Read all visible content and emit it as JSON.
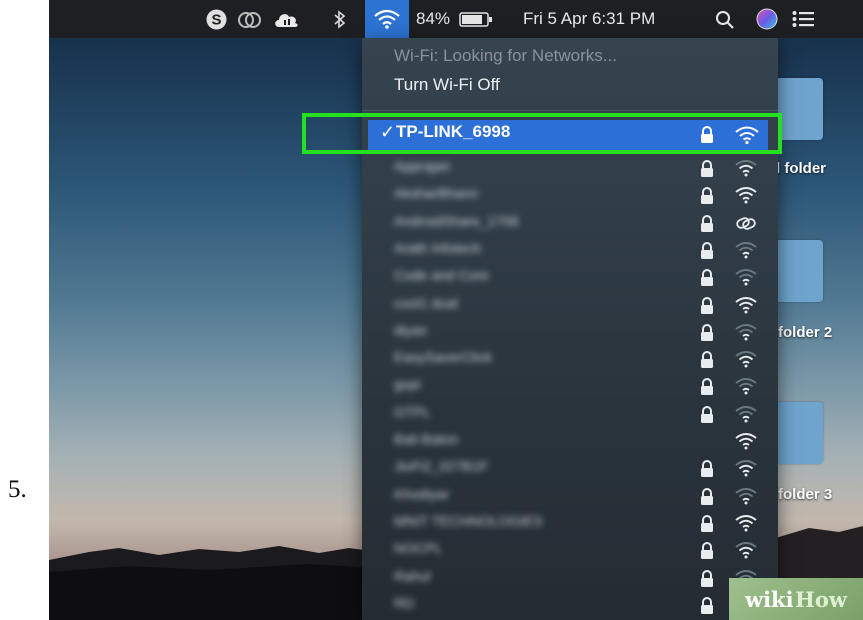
{
  "step_number": "5.",
  "menubar": {
    "battery_percent": "84%",
    "datetime": "Fri 5 Apr  6:31 PM",
    "icons": [
      "skype-icon",
      "creative-cloud-icon",
      "cloud-icon",
      "bluetooth-icon",
      "wifi-icon",
      "battery-icon",
      "search-icon",
      "siri-icon",
      "notification-list-icon"
    ]
  },
  "wifi_menu": {
    "status": "Wi-Fi: Looking for Networks...",
    "toggle_label": "Turn Wi-Fi Off",
    "selected_network": {
      "check": "✓",
      "name": "TP-LINK_6998",
      "locked": true,
      "signal": "wifi-strong-icon"
    },
    "networks": [
      {
        "name": "Apprajan",
        "locked": true,
        "signal": 2
      },
      {
        "name": "AksharBhann",
        "locked": true,
        "signal": 3
      },
      {
        "name": "AndroidShare_1708",
        "locked": true,
        "signal": "hotspot"
      },
      {
        "name": "Arath Infotech",
        "locked": true,
        "signal": 1
      },
      {
        "name": "Code and Core",
        "locked": true,
        "signal": 1
      },
      {
        "name": "cool1 dual",
        "locked": true,
        "signal": 3
      },
      {
        "name": "diyan",
        "locked": true,
        "signal": 1
      },
      {
        "name": "EasySaverClick",
        "locked": true,
        "signal": 2
      },
      {
        "name": "gopi",
        "locked": true,
        "signal": 1
      },
      {
        "name": "GTPL",
        "locked": true,
        "signal": 1
      },
      {
        "name": "Bali-Baton",
        "locked": false,
        "signal": 3
      },
      {
        "name": "JioFi2_027B1F",
        "locked": true,
        "signal": 2
      },
      {
        "name": "Khodiyar",
        "locked": true,
        "signal": 1
      },
      {
        "name": "MNIT TECHNOLOGIES",
        "locked": true,
        "signal": 3
      },
      {
        "name": "NOCPL",
        "locked": true,
        "signal": 2
      },
      {
        "name": "Rahul",
        "locked": true,
        "signal": 1
      },
      {
        "name": "RD",
        "locked": true,
        "signal": 1
      }
    ]
  },
  "desktop": {
    "folders": [
      "l folder",
      "folder 2",
      "folder 3"
    ]
  },
  "watermark": {
    "wiki": "wiki",
    "how": "How"
  }
}
